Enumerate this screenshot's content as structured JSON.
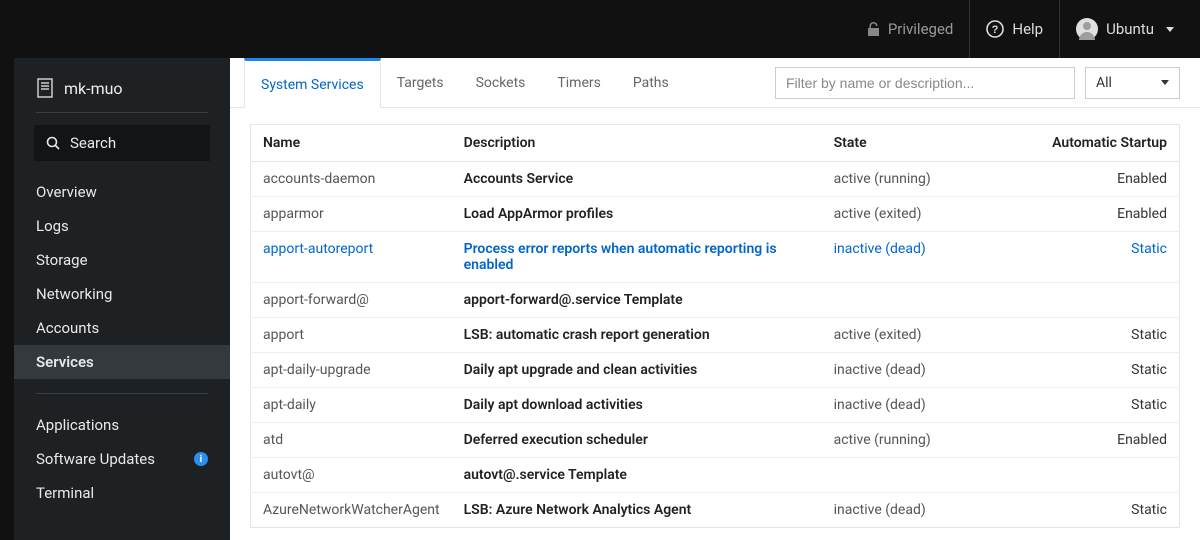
{
  "topbar": {
    "privileged": "Privileged",
    "help": "Help",
    "user": "Ubuntu"
  },
  "sidebar": {
    "host": "mk-muo",
    "search_label": "Search",
    "nav1": [
      {
        "label": "Overview"
      },
      {
        "label": "Logs"
      },
      {
        "label": "Storage"
      },
      {
        "label": "Networking"
      },
      {
        "label": "Accounts"
      },
      {
        "label": "Services",
        "active": true
      }
    ],
    "nav2": [
      {
        "label": "Applications"
      },
      {
        "label": "Software Updates",
        "info": true
      },
      {
        "label": "Terminal"
      }
    ]
  },
  "tabs": [
    {
      "label": "System Services",
      "active": true
    },
    {
      "label": "Targets"
    },
    {
      "label": "Sockets"
    },
    {
      "label": "Timers"
    },
    {
      "label": "Paths"
    }
  ],
  "filter": {
    "placeholder": "Filter by name or description...",
    "select": "All"
  },
  "table": {
    "headers": {
      "name": "Name",
      "desc": "Description",
      "state": "State",
      "startup": "Automatic Startup"
    },
    "rows": [
      {
        "name": "accounts-daemon",
        "desc": "Accounts Service",
        "state": "active (running)",
        "startup": "Enabled"
      },
      {
        "name": "apparmor",
        "desc": "Load AppArmor profiles",
        "state": "active (exited)",
        "startup": "Enabled"
      },
      {
        "name": "apport-autoreport",
        "desc": "Process error reports when automatic reporting is enabled",
        "state": "inactive (dead)",
        "startup": "Static",
        "highlight": true
      },
      {
        "name": "apport-forward@",
        "desc": "apport-forward@.service Template",
        "state": "",
        "startup": ""
      },
      {
        "name": "apport",
        "desc": "LSB: automatic crash report generation",
        "state": "active (exited)",
        "startup": "Static"
      },
      {
        "name": "apt-daily-upgrade",
        "desc": "Daily apt upgrade and clean activities",
        "state": "inactive (dead)",
        "startup": "Static"
      },
      {
        "name": "apt-daily",
        "desc": "Daily apt download activities",
        "state": "inactive (dead)",
        "startup": "Static"
      },
      {
        "name": "atd",
        "desc": "Deferred execution scheduler",
        "state": "active (running)",
        "startup": "Enabled"
      },
      {
        "name": "autovt@",
        "desc": "autovt@.service Template",
        "state": "",
        "startup": ""
      },
      {
        "name": "AzureNetworkWatcherAgent",
        "desc": "LSB: Azure Network Analytics Agent",
        "state": "inactive (dead)",
        "startup": "Static"
      }
    ]
  }
}
